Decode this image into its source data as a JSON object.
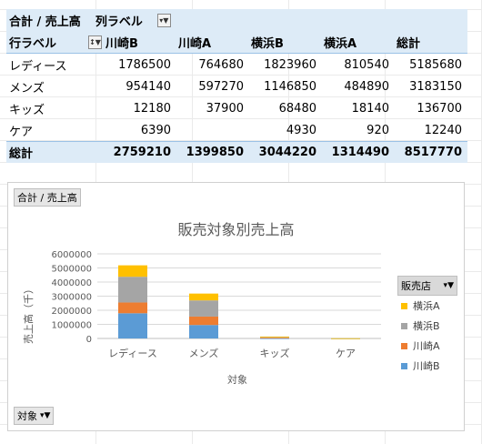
{
  "pivot": {
    "title": "合計 / 売上高",
    "col_label": "列ラベル",
    "row_label": "行ラベル",
    "columns": [
      "川崎B",
      "川崎A",
      "横浜B",
      "横浜A",
      "総計"
    ],
    "rows": [
      {
        "label": "レディース",
        "values": [
          "1786500",
          "764680",
          "1823960",
          "810540",
          "5185680"
        ]
      },
      {
        "label": "メンズ",
        "values": [
          "954140",
          "597270",
          "1146850",
          "484890",
          "3183150"
        ]
      },
      {
        "label": "キッズ",
        "values": [
          "12180",
          "37900",
          "68480",
          "18140",
          "136700"
        ]
      },
      {
        "label": "ケア",
        "values": [
          "6390",
          "",
          "4930",
          "920",
          "12240"
        ]
      }
    ],
    "total": {
      "label": "総計",
      "values": [
        "2759210",
        "1399850",
        "3044220",
        "1314490",
        "8517770"
      ]
    }
  },
  "chart_buttons": {
    "value_field": "合計 / 売上高",
    "axis_field": "対象"
  },
  "chart_data": {
    "type": "bar",
    "stacked": true,
    "title": "販売対象別売上高",
    "xlabel": "対象",
    "ylabel": "売上高（千）",
    "ylim": [
      0,
      6000000
    ],
    "yticks": [
      "0",
      "1000000",
      "2000000",
      "3000000",
      "4000000",
      "5000000",
      "6000000"
    ],
    "categories": [
      "レディース",
      "メンズ",
      "キッズ",
      "ケア"
    ],
    "legend_title": "販売店",
    "legend_position": "right",
    "series": [
      {
        "name": "川崎B",
        "color": "#5b9bd5",
        "values": [
          1786500,
          954140,
          12180,
          6390
        ]
      },
      {
        "name": "川崎A",
        "color": "#ed7d31",
        "values": [
          764680,
          597270,
          37900,
          0
        ]
      },
      {
        "name": "横浜B",
        "color": "#a5a5a5",
        "values": [
          1823960,
          1146850,
          68480,
          4930
        ]
      },
      {
        "name": "横浜A",
        "color": "#ffc000",
        "values": [
          810540,
          484890,
          18140,
          920
        ]
      }
    ]
  }
}
